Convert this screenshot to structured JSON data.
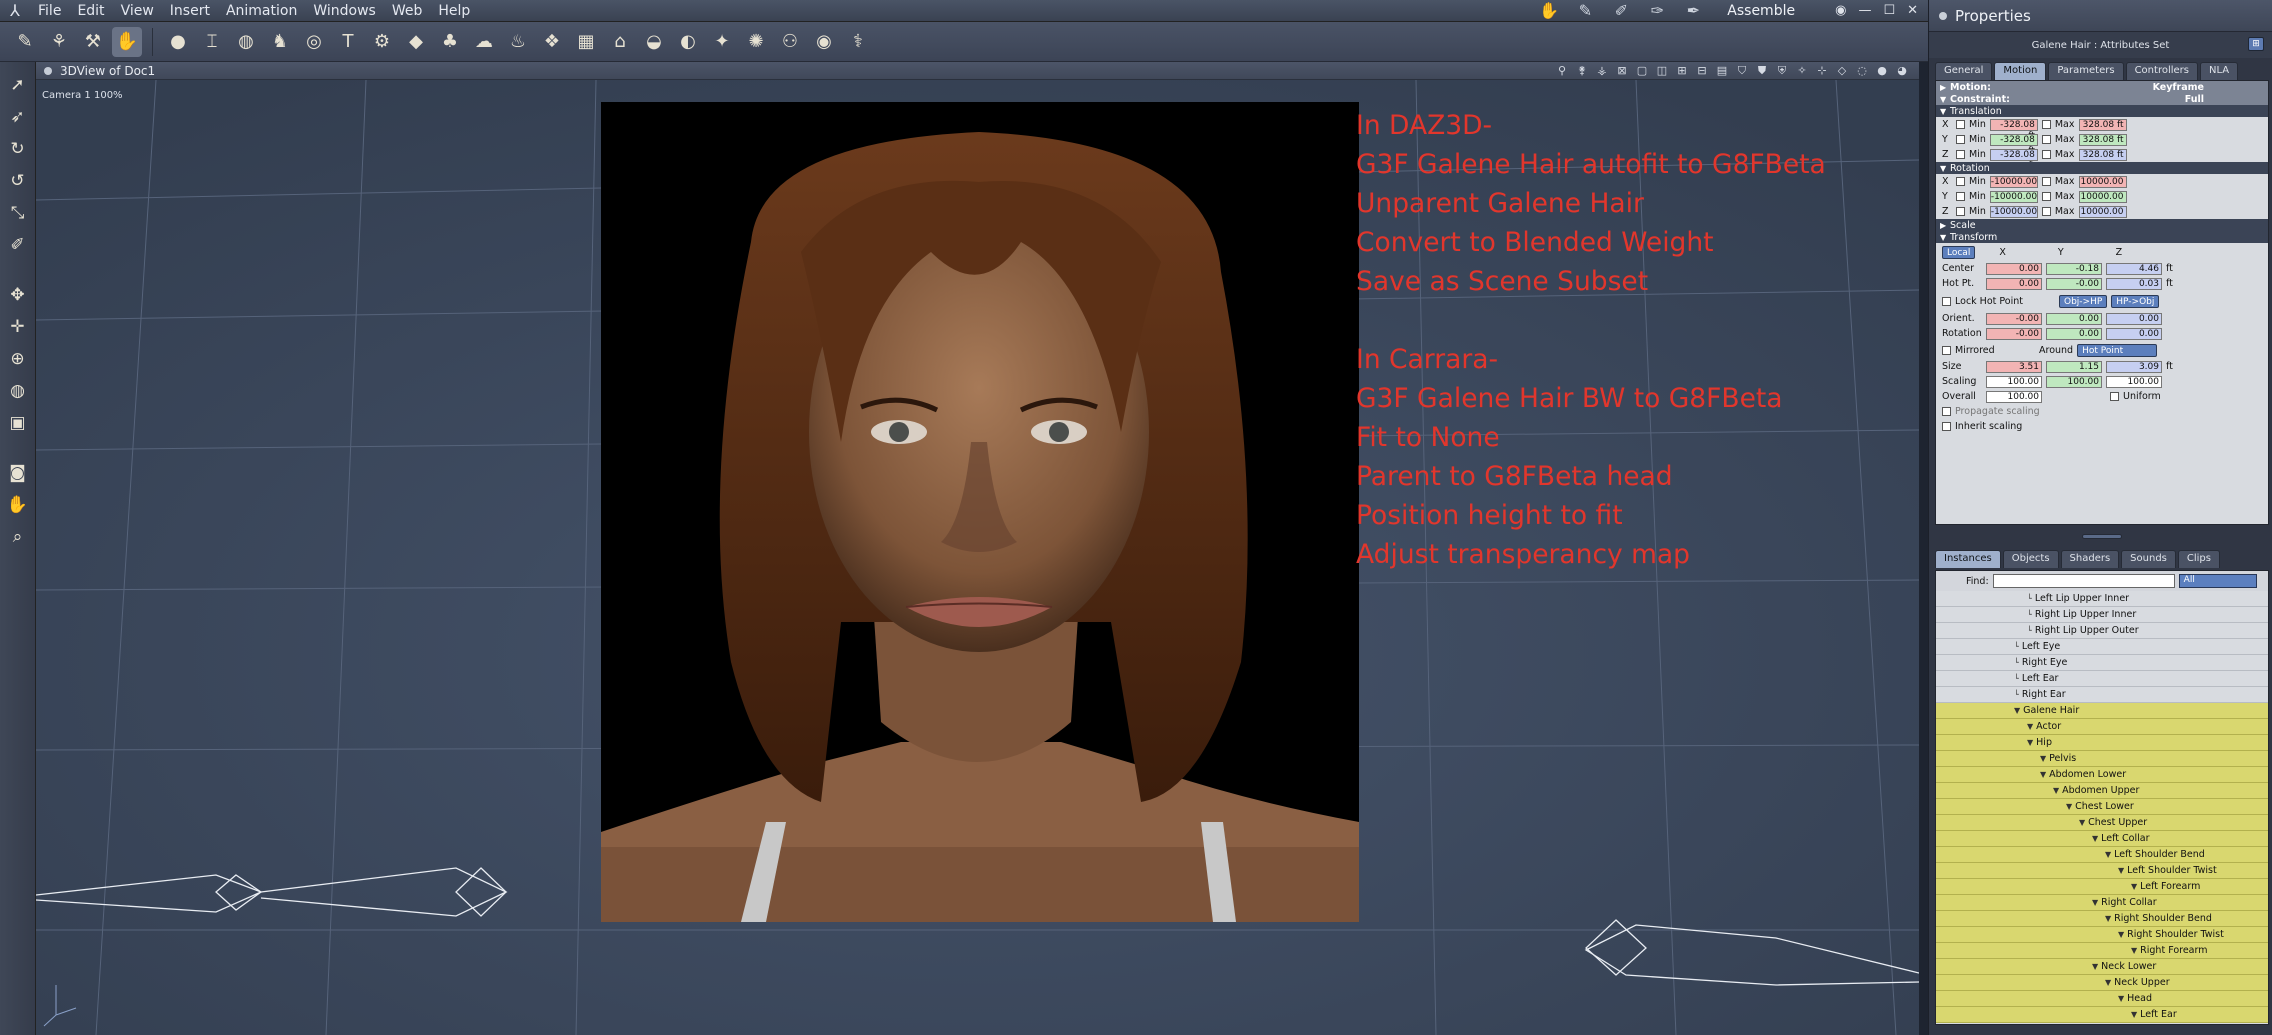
{
  "menubar": {
    "items": [
      "File",
      "Edit",
      "View",
      "Insert",
      "Animation",
      "Windows",
      "Web",
      "Help"
    ],
    "room_label": "Assemble"
  },
  "viewport": {
    "title": "3DView of Doc1",
    "camera_label": "Camera 1 100%"
  },
  "overlay_text": [
    "In DAZ3D-",
    "G3F Galene Hair autofit to G8FBeta",
    "Unparent Galene Hair",
    "Convert to Blended Weight",
    "Save as Scene Subset",
    "",
    "In Carrara-",
    "G3F Galene Hair BW to G8FBeta",
    "Fit to None",
    "Parent to G8FBeta head",
    "Position height to fit",
    "Adjust transperancy map"
  ],
  "properties": {
    "title": "Properties",
    "subtitle": "Galene Hair : Attributes Set",
    "tabs": [
      "General",
      "Motion",
      "Parameters",
      "Controllers",
      "NLA"
    ],
    "active_tab": "Motion",
    "motion_label": "Motion:",
    "motion_value": "Keyframe",
    "constraint_label": "Constraint:",
    "constraint_value": "Full",
    "translation_label": "Translation",
    "translation": [
      {
        "axis": "X",
        "min": "-328.08 ft",
        "max": "328.08 ft"
      },
      {
        "axis": "Y",
        "min": "-328.08 ft",
        "max": "328.08 ft"
      },
      {
        "axis": "Z",
        "min": "-328.08 ft",
        "max": "328.08 ft"
      }
    ],
    "rotation_label": "Rotation",
    "rotation": [
      {
        "axis": "X",
        "min": "-10000.00",
        "max": "10000.00"
      },
      {
        "axis": "Y",
        "min": "-10000.00",
        "max": "10000.00"
      },
      {
        "axis": "Z",
        "min": "-10000.00",
        "max": "10000.00"
      }
    ],
    "min_label": "Min",
    "max_label": "Max",
    "scale_label": "Scale",
    "transform_label": "Transform",
    "local_label": "Local",
    "xyz": [
      "X",
      "Y",
      "Z"
    ],
    "center": {
      "label": "Center",
      "x": "0.00",
      "y": "-0.18",
      "z": "4.46",
      "unit": "ft"
    },
    "hotpt": {
      "label": "Hot Pt.",
      "x": "0.00",
      "y": "-0.00",
      "z": "0.03",
      "unit": "ft"
    },
    "lock_hot_point": "Lock Hot Point",
    "obj_hp": "Obj->HP",
    "hp_obj": "HP->Obj",
    "orient": {
      "label": "Orient.",
      "x": "-0.00",
      "y": "0.00",
      "z": "0.00"
    },
    "rotation_row": {
      "label": "Rotation",
      "x": "-0.00",
      "y": "0.00",
      "z": "0.00"
    },
    "mirrored": "Mirrored",
    "around": "Around",
    "hot_point": "Hot Point",
    "size": {
      "label": "Size",
      "x": "3.51",
      "y": "1.15",
      "z": "3.09",
      "unit": "ft"
    },
    "scaling": {
      "label": "Scaling",
      "x": "100.00",
      "y": "100.00",
      "z": "100.00"
    },
    "overall": {
      "label": "Overall",
      "value": "100.00"
    },
    "uniform": "Uniform",
    "propagate_scaling": "Propagate scaling",
    "inherit_scaling": "Inherit scaling"
  },
  "instances": {
    "tabs": [
      "Instances",
      "Objects",
      "Shaders",
      "Sounds",
      "Clips"
    ],
    "active_tab": "Instances",
    "find_label": "Find:",
    "find_value": "",
    "filter": "All",
    "rows": [
      {
        "label": "Left Lip Upper Inner",
        "depth": 7,
        "selected": false
      },
      {
        "label": "Right Lip Upper Inner",
        "depth": 7,
        "selected": false
      },
      {
        "label": "Right Lip Upper Outer",
        "depth": 7,
        "selected": false
      },
      {
        "label": "Left Eye",
        "depth": 6,
        "selected": false
      },
      {
        "label": "Right Eye",
        "depth": 6,
        "selected": false
      },
      {
        "label": "Left Ear",
        "depth": 6,
        "selected": false
      },
      {
        "label": "Right Ear",
        "depth": 6,
        "selected": false
      },
      {
        "label": "Galene Hair",
        "depth": 6,
        "selected": true
      },
      {
        "label": "Actor",
        "depth": 7,
        "selected": true
      },
      {
        "label": "Hip",
        "depth": 7,
        "selected": true
      },
      {
        "label": "Pelvis",
        "depth": 8,
        "selected": true
      },
      {
        "label": "Abdomen Lower",
        "depth": 8,
        "selected": true
      },
      {
        "label": "Abdomen Upper",
        "depth": 9,
        "selected": true
      },
      {
        "label": "Chest Lower",
        "depth": 10,
        "selected": true
      },
      {
        "label": "Chest Upper",
        "depth": 11,
        "selected": true
      },
      {
        "label": "Left Collar",
        "depth": 12,
        "selected": true
      },
      {
        "label": "Left Shoulder Bend",
        "depth": 13,
        "selected": true
      },
      {
        "label": "Left Shoulder Twist",
        "depth": 14,
        "selected": true
      },
      {
        "label": "Left Forearm",
        "depth": 15,
        "selected": true
      },
      {
        "label": "Right Collar",
        "depth": 12,
        "selected": true
      },
      {
        "label": "Right Shoulder Bend",
        "depth": 13,
        "selected": true
      },
      {
        "label": "Right Shoulder Twist",
        "depth": 14,
        "selected": true
      },
      {
        "label": "Right Forearm",
        "depth": 15,
        "selected": true
      },
      {
        "label": "Neck Lower",
        "depth": 12,
        "selected": true
      },
      {
        "label": "Neck Upper",
        "depth": 13,
        "selected": true
      },
      {
        "label": "Head",
        "depth": 14,
        "selected": true
      },
      {
        "label": "Left Ear",
        "depth": 15,
        "selected": true
      }
    ]
  }
}
